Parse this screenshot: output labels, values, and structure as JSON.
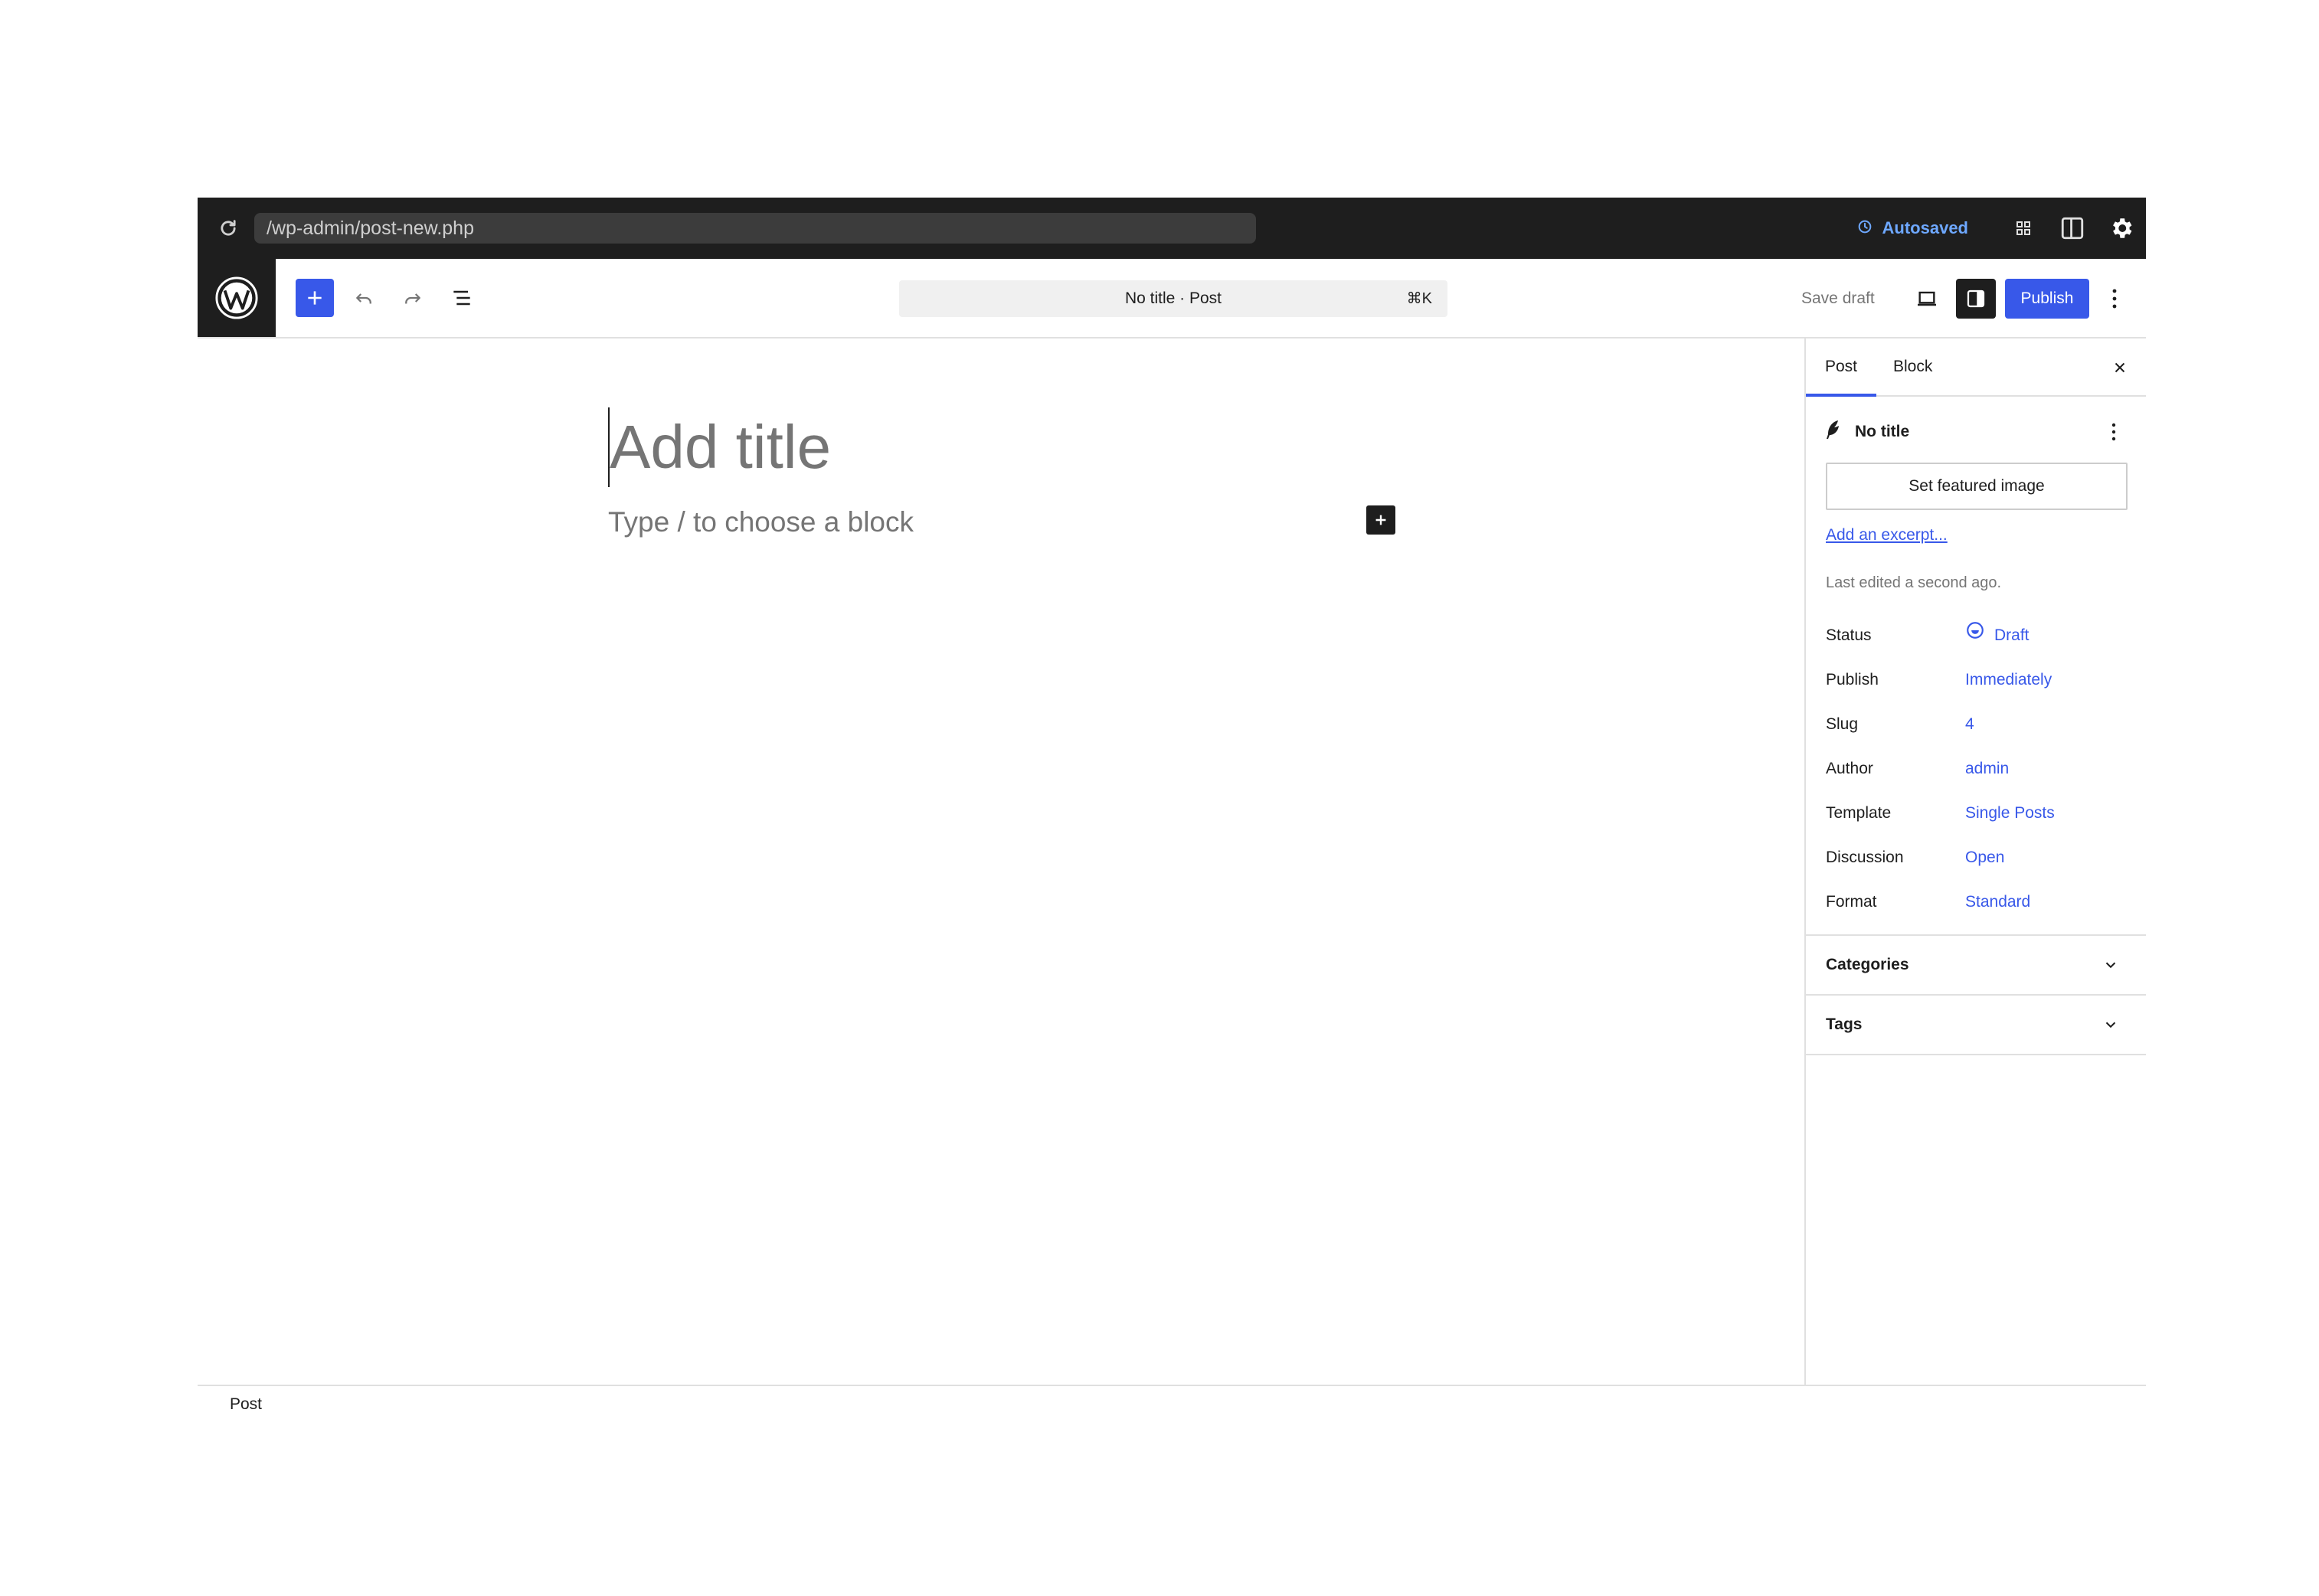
{
  "browser": {
    "url": "/wp-admin/post-new.php",
    "autosave_status": "Autosaved",
    "accent_color": "#6ea8ff"
  },
  "header": {
    "command_bar_label": "No title · Post",
    "command_shortcut": "⌘K",
    "save_draft_label": "Save draft",
    "publish_label": "Publish",
    "brand_color": "#3858e9"
  },
  "canvas": {
    "title_placeholder": "Add title",
    "block_placeholder": "Type / to choose a block"
  },
  "sidebar": {
    "tabs": [
      {
        "label": "Post",
        "active": true
      },
      {
        "label": "Block",
        "active": false
      }
    ],
    "post_title": "No title",
    "featured_image_label": "Set featured image",
    "excerpt_link": "Add an excerpt...",
    "last_edited": "Last edited a second ago.",
    "meta": [
      {
        "label": "Status",
        "value": "Draft"
      },
      {
        "label": "Publish",
        "value": "Immediately"
      },
      {
        "label": "Slug",
        "value": "4"
      },
      {
        "label": "Author",
        "value": "admin"
      },
      {
        "label": "Template",
        "value": "Single Posts"
      },
      {
        "label": "Discussion",
        "value": "Open"
      },
      {
        "label": "Format",
        "value": "Standard"
      }
    ],
    "panels": [
      {
        "title": "Categories",
        "expanded": false
      },
      {
        "title": "Tags",
        "expanded": false
      }
    ]
  },
  "footer": {
    "breadcrumb": "Post"
  }
}
